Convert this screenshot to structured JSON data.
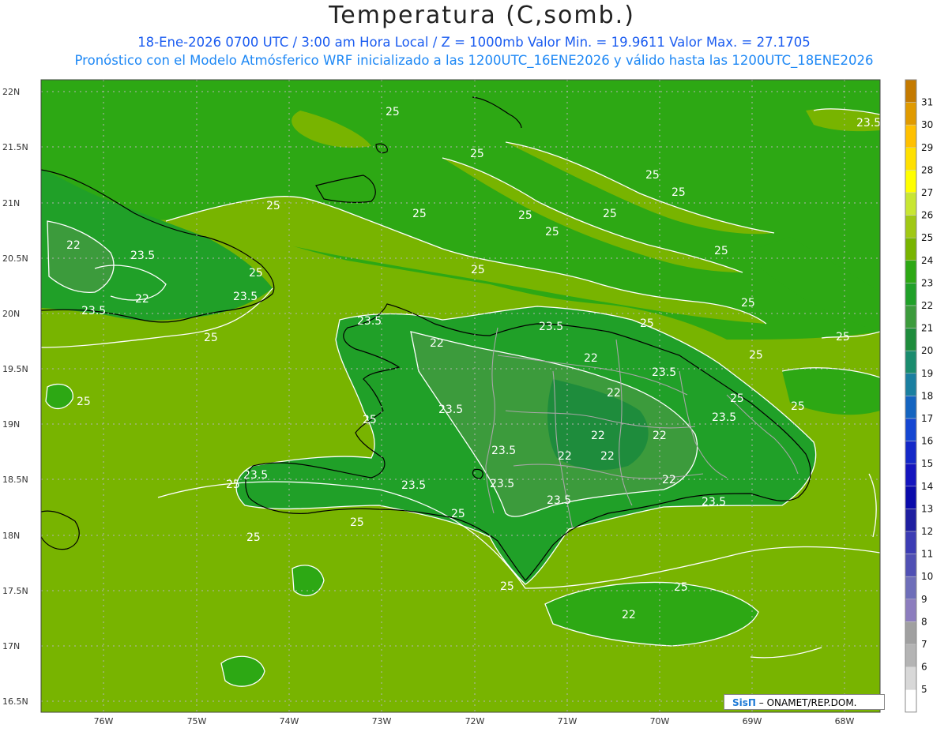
{
  "title": "Temperatura (C,somb.)",
  "subtitle_line1": "18-Ene-2026  0700 UTC / 3:00 am Hora Local / Z = 1000mb   Valor Min. = 19.9611  Valor Max. = 27.1705",
  "subtitle_line2": "Pronóstico con el Modelo Atmósferico WRF inicializado a las 1200UTC_16ENE2026 y válido hasta las  1200UTC_18ENE2026",
  "credit": {
    "logo": "SisΠ",
    "text": "– ONAMET/REP.DOM."
  },
  "axes": {
    "lat_labels": [
      "22N",
      "21.5N",
      "21N",
      "20.5N",
      "20N",
      "19.5N",
      "19N",
      "18.5N",
      "18N",
      "17.5N",
      "17N",
      "16.5N"
    ],
    "lon_labels": [
      "76W",
      "75W",
      "74W",
      "73W",
      "72W",
      "71W",
      "70W",
      "69W",
      "68W"
    ]
  },
  "contour_labels": [
    "25",
    "25",
    "25",
    "25",
    "25",
    "25",
    "25",
    "25",
    "25",
    "25",
    "25",
    "25",
    "25",
    "25",
    "25",
    "25",
    "25",
    "25",
    "25",
    "25",
    "25",
    "25",
    "25",
    "25",
    "25",
    "25",
    "25",
    "23.5",
    "23.5",
    "23.5",
    "23.5",
    "23.5",
    "23.5",
    "23.5",
    "23.5",
    "23.5",
    "23.5",
    "23.5",
    "23.5",
    "23.5",
    "23.5",
    "23.5",
    "22",
    "22",
    "22",
    "22",
    "22",
    "22",
    "22",
    "22",
    "22",
    "22",
    "22"
  ],
  "colorbar": {
    "labels": [
      "31",
      "30",
      "29",
      "28",
      "27",
      "26",
      "25",
      "24",
      "23",
      "22",
      "21",
      "20",
      "19",
      "18",
      "17",
      "16",
      "15",
      "14",
      "13",
      "12",
      "11",
      "10",
      "9",
      "8",
      "7",
      "6",
      "5"
    ],
    "colors": [
      "#c47a00",
      "#e09a00",
      "#ffc000",
      "#ffe000",
      "#ffff00",
      "#c8e632",
      "#a0c814",
      "#78b400",
      "#2da814",
      "#20a028",
      "#3c9b3c",
      "#1e8c3c",
      "#1a8c6e",
      "#1a7fa0",
      "#1464c0",
      "#1446d2",
      "#1428c8",
      "#1414be",
      "#0a0aaa",
      "#1e1ea0",
      "#3c3cb4",
      "#5050b4",
      "#6e6eb9",
      "#8c7dbe",
      "#a0a0a0",
      "#b4b4b4",
      "#d8d8d8",
      "#ffffff"
    ]
  }
}
